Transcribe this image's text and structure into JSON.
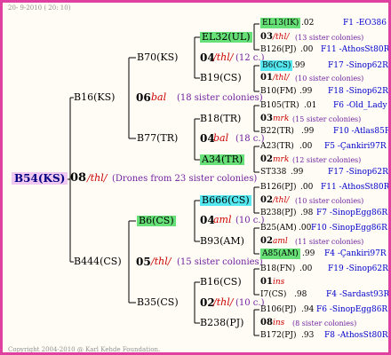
{
  "header": "20- 9-2010 ( 20: 10)",
  "footer": "Copyright 2004-2010 @ Karl Kehde Foundation.",
  "tree": {
    "root": "B54(KS)",
    "root_gen": "08",
    "root_code": "/thl/",
    "root_sis": "(Drones from 23 sister colonies)",
    "l1": [
      {
        "name": "B16(KS)",
        "gen": "06",
        "code": "bal",
        "sis": "(18 sister colonies)"
      },
      {
        "name": "B444(CS)",
        "gen": "05",
        "code": "/thl/",
        "sis": "(15 sister colonies)"
      }
    ],
    "l2": [
      {
        "name": "B70(KS)",
        "gen": "04",
        "code": "/thl/",
        "sis": "(12 c.)"
      },
      {
        "name": "B77(TR)",
        "gen": "04",
        "code": "bal",
        "sis": "(18 c.)"
      },
      {
        "name": "B6(CS)",
        "gen": "04",
        "code": "aml",
        "sis": "(10 c.)"
      },
      {
        "name": "B35(CS)",
        "gen": "02",
        "code": "/thl/",
        "sis": "(10 c.)"
      }
    ],
    "l3": [
      {
        "name": "EL32(UL)",
        "gen": "01",
        "code": "/thl/",
        "sis": "(10 sister colonies)"
      },
      {
        "name": "B19(CS)",
        "gen": "",
        "code": "",
        "sis": ""
      },
      {
        "name": "B18(TR)",
        "gen": "03",
        "code": "mrk",
        "sis": "(15 sister colonies)"
      },
      {
        "name": "A34(TR)",
        "gen": "02",
        "code": "mrk",
        "sis": "(12 sister colonies)"
      },
      {
        "name": "B666(CS)",
        "gen": "02",
        "code": "/thl/",
        "sis": "(10 sister colonies)"
      },
      {
        "name": "B93(AM)",
        "gen": "02",
        "code": "aml",
        "sis": "(11 sister colonies)"
      },
      {
        "name": "B16(CS)",
        "gen": "01",
        "code": "ins",
        "sis": ""
      },
      {
        "name": "B238(PJ)",
        "gen": "08",
        "code": "ins",
        "sis": "(8 sister colonies)"
      }
    ],
    "l4": [
      {
        "name": "EL13(IK)",
        "val": ".02",
        "id": "F1 -EO386"
      },
      {
        "gen": "03",
        "code": "/thl/",
        "sis": "(13 sister colonies)"
      },
      {
        "name": "B126(PJ)",
        "val": ".00",
        "id": "F11 -AthosSt80R"
      },
      {
        "name": "B6(CS)",
        "val": ".99",
        "id": "F17 -Sinop62R"
      },
      {
        "gen": "01",
        "code": "/thl/",
        "sis": "(10 sister colonies)"
      },
      {
        "name": "B10(FM)",
        "val": ".99",
        "id": "F18 -Sinop62R"
      },
      {
        "name": "B105(TR)",
        "val": ".01",
        "id": "F6 -Old_Lady"
      },
      {
        "gen": "03",
        "code": "mrk",
        "sis": "(15 sister colonies)"
      },
      {
        "name": "B22(TR)",
        "val": ".99",
        "id": "F10 -Atlas85R"
      },
      {
        "name": "A23(TR)",
        "val": ".00",
        "id": "F5 -Çankiri97R"
      },
      {
        "gen": "02",
        "code": "mrk",
        "sis": "(12 sister colonies)"
      },
      {
        "name": "ST338",
        "val": ".99",
        "id": "F17 -Sinop62R"
      },
      {
        "name": "B126(PJ)",
        "val": ".00",
        "id": "F11 -AthosSt80R"
      },
      {
        "gen": "02",
        "code": "/thl/",
        "sis": "(10 sister colonies)"
      },
      {
        "name": "B238(PJ)",
        "val": ".98",
        "id": "F7 -SinopEgg86R"
      },
      {
        "name": "B25(AM)",
        "val": ".00",
        "id": "F10 -SinopEgg86R"
      },
      {
        "gen": "02",
        "code": "aml",
        "sis": "(11 sister colonies)"
      },
      {
        "name": "A85(AM)",
        "val": ".99",
        "id": "F4 -Çankiri97R"
      },
      {
        "name": "B18(FN)",
        "val": ".00",
        "id": "F19 -Sinop62R"
      },
      {
        "gen": "01",
        "code": "ins",
        "sis": ""
      },
      {
        "name": "I7(CS)",
        "val": ".98",
        "id": "F4 -Sardast93R"
      },
      {
        "name": "B106(PJ)",
        "val": ".94",
        "id": "F6 -SinopEgg86R"
      },
      {
        "gen": "08",
        "code": "ins",
        "sis": "(8 sister colonies)"
      },
      {
        "name": "B172(PJ)",
        "val": ".93",
        "id": "F8 -AthosSt80R"
      }
    ]
  },
  "colors": {
    "border": "#e040a0",
    "line": "#000000",
    "green": "#66e077",
    "cyan": "#55e8f0",
    "root_bg": "#f0c8f0",
    "id_blue": "#0000cc"
  }
}
